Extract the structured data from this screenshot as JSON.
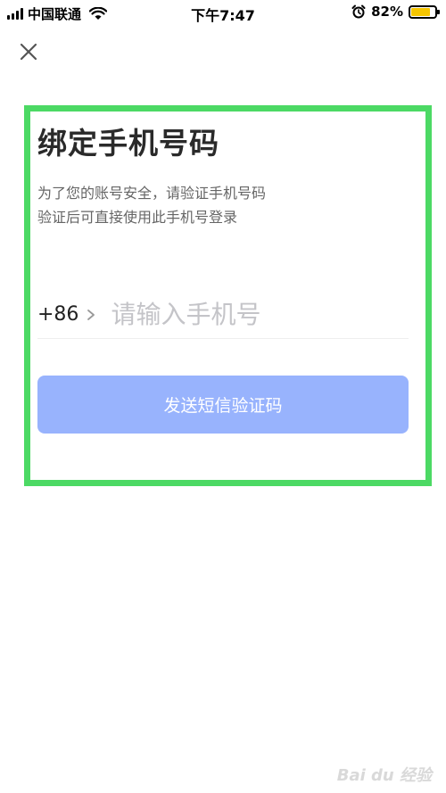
{
  "status_bar": {
    "carrier": "中国联通",
    "time": "下午7:47",
    "battery": "82%",
    "battery_level": 0.82
  },
  "page": {
    "title": "绑定手机号码",
    "desc_line1": "为了您的账号安全，请验证手机号码",
    "desc_line2": "验证后可直接使用此手机号登录"
  },
  "form": {
    "country_code": "+86",
    "phone_value": "",
    "phone_placeholder": "请输入手机号",
    "send_label": "发送短信验证码"
  },
  "watermark": "Bai du 经验",
  "colors": {
    "primary_button": "#98b3fd",
    "highlight": "#4cd964",
    "battery": "#f5c500"
  },
  "icons": [
    "signal-icon",
    "wifi-icon",
    "alarm-icon",
    "battery-icon",
    "close-icon",
    "chevron-right-icon"
  ]
}
